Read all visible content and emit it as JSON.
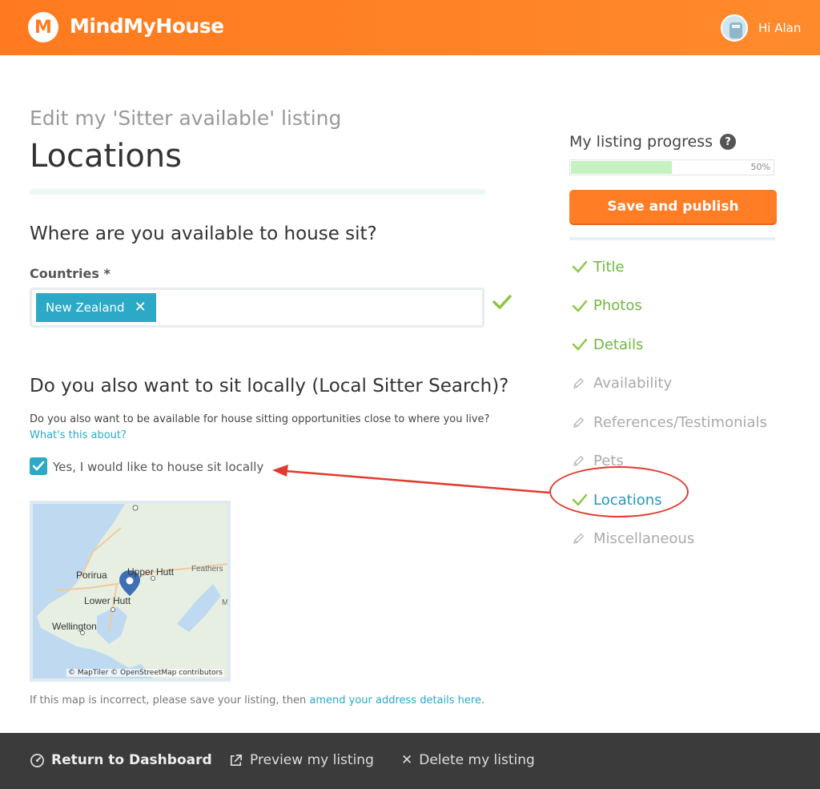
{
  "header": {
    "logo_letter": "M",
    "brand": "MindMyHouse",
    "greeting": "Hi Alan"
  },
  "main": {
    "subtitle": "Edit my 'Sitter available' listing",
    "title": "Locations",
    "section1_heading": "Where are you available to house sit?",
    "countries_label": "Countries *",
    "country_tags": [
      "New Zealand"
    ],
    "section2_heading": "Do you also want to sit locally (Local Sitter Search)?",
    "local_description": "Do you also want to be available for house sitting opportunities close to where you live?",
    "whats_this_link": "What's this about?",
    "local_checkbox_label": "Yes, I would like to house sit locally",
    "local_checked": true,
    "map": {
      "labels": [
        "Porirua",
        "Upper Hutt",
        "Feathers",
        "Lower Hutt",
        "Wellington",
        "M"
      ],
      "credit": "© MapTiler © OpenStreetMap contributors"
    },
    "map_note_prefix": "If this map is incorrect, please save your listing, then ",
    "map_note_link": "amend your address details here",
    "map_note_suffix": "."
  },
  "sidebar": {
    "progress_title": "My listing progress",
    "help_glyph": "?",
    "progress_percent": 50,
    "progress_label": "50%",
    "save_button": "Save and publish",
    "steps": [
      {
        "label": "Title",
        "state": "done"
      },
      {
        "label": "Photos",
        "state": "done"
      },
      {
        "label": "Details",
        "state": "done"
      },
      {
        "label": "Availability",
        "state": "todo"
      },
      {
        "label": "References/Testimonials",
        "state": "todo"
      },
      {
        "label": "Pets",
        "state": "todo"
      },
      {
        "label": "Locations",
        "state": "active"
      },
      {
        "label": "Miscellaneous",
        "state": "todo"
      }
    ]
  },
  "footer": {
    "dashboard": "Return to Dashboard",
    "preview": "Preview my listing",
    "delete": "Delete my listing"
  },
  "colors": {
    "brand_orange": "#ff7a1f",
    "accent_teal": "#2ba9c6",
    "done_green": "#6fb83f",
    "annotation_red": "#e23a2e",
    "footer_bg": "#3b3b3b"
  }
}
